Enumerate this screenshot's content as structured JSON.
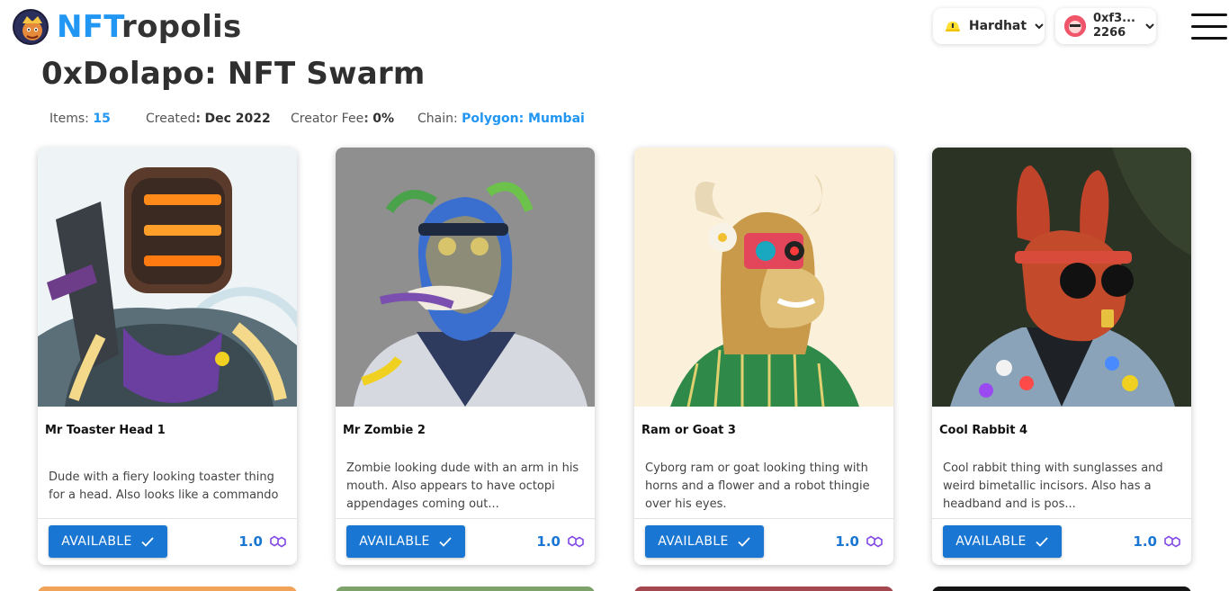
{
  "app": {
    "brand_prefix": "NFT",
    "brand_suffix": "ropolis"
  },
  "header": {
    "network": {
      "label": "Hardhat",
      "icon": "hardhat-icon"
    },
    "account": {
      "line1": "0xf3...",
      "line2": "2266",
      "icon": "account-avatar-icon"
    },
    "menu_icon": "hamburger-menu-icon"
  },
  "collection": {
    "title": "0xDolapo: NFT Swarm",
    "items_label": "Items",
    "items_value": "15",
    "created_label": "Created",
    "created_value": "Dec 2022",
    "fee_label": "Creator Fee",
    "fee_value": "0%",
    "chain_label": "Chain",
    "chain_value": "Polygon: Mumbai"
  },
  "cards": [
    {
      "title": "Mr Toaster Head 1",
      "description": "Dude with a fiery looking toaster thing for a head. Also looks like a commando",
      "status": "AVAILABLE",
      "price": "1.0"
    },
    {
      "title": "Mr Zombie 2",
      "description": "Zombie looking dude with an arm in his mouth. Also appears to have octopi appendages coming out...",
      "status": "AVAILABLE",
      "price": "1.0"
    },
    {
      "title": "Ram or Goat 3",
      "description": "Cyborg ram or goat looking thing with horns and a flower and a robot thingie over his eyes.",
      "status": "AVAILABLE",
      "price": "1.0"
    },
    {
      "title": "Cool Rabbit 4",
      "description": "Cool rabbit thing with sunglasses and weird bimetallic incisors. Also has a headband and is pos...",
      "status": "AVAILABLE",
      "price": "1.0"
    }
  ],
  "colors": {
    "accent": "#2196f3",
    "button": "#1976d2",
    "price": "#1976d2",
    "polygon": "#8247e5"
  }
}
